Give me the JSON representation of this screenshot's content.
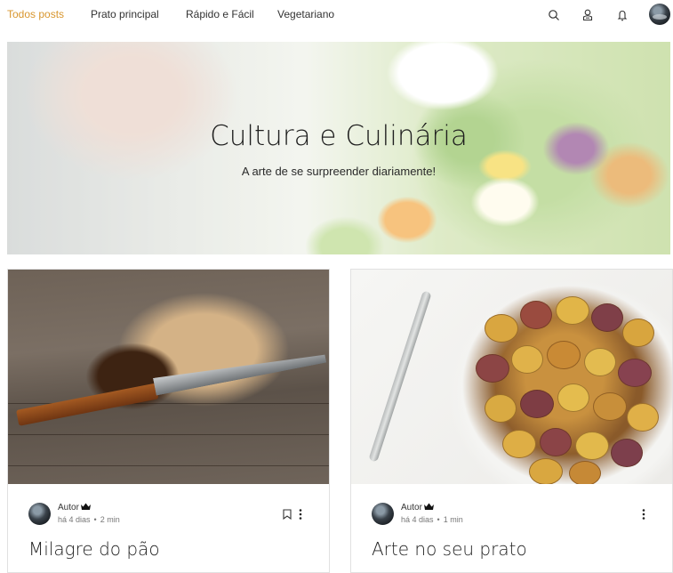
{
  "nav": {
    "items": [
      {
        "label": "Todos posts",
        "active": true
      },
      {
        "label": "Prato principal",
        "active": false
      },
      {
        "label": "Rápido e Fácil",
        "active": false
      },
      {
        "label": "Vegetariano",
        "active": false
      }
    ],
    "icons": [
      "search-icon",
      "profile-icon",
      "notification-bell-icon",
      "user-avatar"
    ],
    "accent_color": "#d8962e"
  },
  "hero": {
    "title": "Cultura e Culinária",
    "subtitle": "A arte de se surpreender diariamente!"
  },
  "posts": [
    {
      "author": "Autor",
      "time_ago": "há 4 dias",
      "read_time": "2 min",
      "title": "Milagre do pão",
      "image": "bread-with-knife-photo",
      "bookmark": true
    },
    {
      "author": "Autor",
      "time_ago": "há 4 dias",
      "read_time": "1 min",
      "title": "Arte no seu prato",
      "image": "roasted-potato-slices-photo",
      "bookmark": false
    }
  ],
  "separator": "•"
}
